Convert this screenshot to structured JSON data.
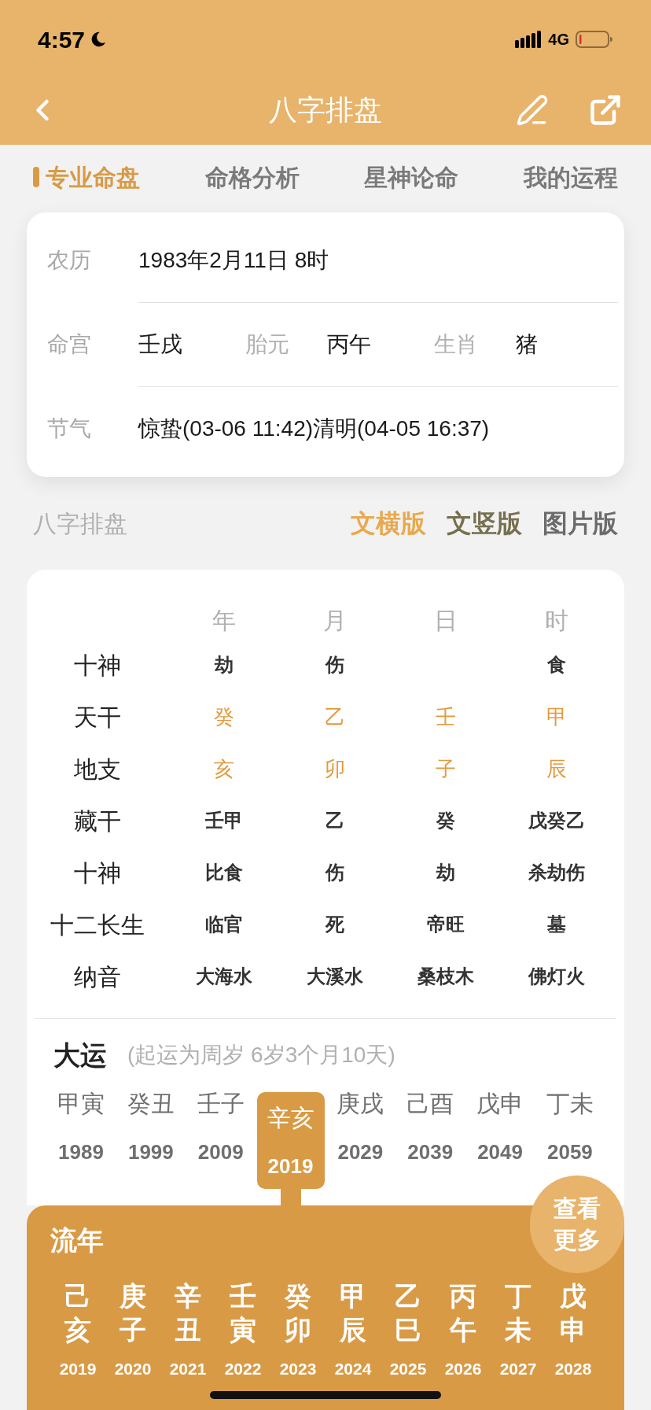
{
  "status_bar": {
    "time": "4:57",
    "network": "4G"
  },
  "nav": {
    "title": "八字排盘"
  },
  "tabs": [
    {
      "label": "专业命盘",
      "selected": true
    },
    {
      "label": "命格分析",
      "selected": false
    },
    {
      "label": "星神论命",
      "selected": false
    },
    {
      "label": "我的运程",
      "selected": false
    }
  ],
  "info": [
    {
      "items": [
        {
          "label": "农历",
          "value": "1983年2月11日 8时"
        }
      ]
    },
    {
      "items": [
        {
          "label": "命宫",
          "value": "壬戌"
        },
        {
          "label": "胎元",
          "value": "丙午"
        },
        {
          "label": "生肖",
          "value": "猪"
        }
      ]
    },
    {
      "items": [
        {
          "label": "节气",
          "value": "惊蛰(03-06 11:42)清明(04-05 16:37)"
        }
      ]
    }
  ],
  "section": {
    "title": "八字排盘",
    "versions": [
      {
        "label": "文横版",
        "color": "#e8a94e"
      },
      {
        "label": "文竖版",
        "color": "#76704f"
      },
      {
        "label": "图片版",
        "color": "#6b6b6b"
      }
    ]
  },
  "chart": {
    "columns": [
      "年",
      "月",
      "日",
      "时"
    ],
    "rows": [
      {
        "label": "十神",
        "highlight": false,
        "cells": [
          "劫",
          "伤",
          null,
          "食"
        ]
      },
      {
        "label": "天干",
        "highlight": true,
        "cells": [
          "癸",
          "乙",
          "壬",
          "甲"
        ]
      },
      {
        "label": "地支",
        "highlight": true,
        "cells": [
          "亥",
          "卯",
          "子",
          "辰"
        ]
      },
      {
        "label": "藏干",
        "highlight": false,
        "cells": [
          "壬甲",
          "乙",
          "癸",
          "戊癸乙"
        ]
      },
      {
        "label": "十神",
        "highlight": false,
        "cells": [
          "比食",
          "伤",
          "劫",
          "杀劫伤"
        ]
      },
      {
        "label": "十二长生",
        "highlight": false,
        "cells": [
          "临官",
          "死",
          "帝旺",
          "墓"
        ]
      },
      {
        "label": "纳音",
        "highlight": false,
        "cells": [
          "大海水",
          "大溪水",
          "桑枝木",
          "佛灯火"
        ]
      }
    ]
  },
  "dayun": {
    "title": "大运",
    "note": "(起运为周岁 6岁3个月10天)",
    "items": [
      {
        "pillar": "甲寅",
        "year": "1989",
        "selected": false
      },
      {
        "pillar": "癸丑",
        "year": "1999",
        "selected": false
      },
      {
        "pillar": "壬子",
        "year": "2009",
        "selected": false
      },
      {
        "pillar": "辛亥",
        "year": "2019",
        "selected": true
      },
      {
        "pillar": "庚戌",
        "year": "2029",
        "selected": false
      },
      {
        "pillar": "己酉",
        "year": "2039",
        "selected": false
      },
      {
        "pillar": "戊申",
        "year": "2049",
        "selected": false
      },
      {
        "pillar": "丁未",
        "year": "2059",
        "selected": false
      }
    ]
  },
  "liunian": {
    "title": "流年",
    "more": "查看更多",
    "items": [
      {
        "stem": "己",
        "branch": "亥",
        "year": "2019"
      },
      {
        "stem": "庚",
        "branch": "子",
        "year": "2020"
      },
      {
        "stem": "辛",
        "branch": "丑",
        "year": "2021"
      },
      {
        "stem": "壬",
        "branch": "寅",
        "year": "2022"
      },
      {
        "stem": "癸",
        "branch": "卯",
        "year": "2023"
      },
      {
        "stem": "甲",
        "branch": "辰",
        "year": "2024"
      },
      {
        "stem": "乙",
        "branch": "巳",
        "year": "2025"
      },
      {
        "stem": "丙",
        "branch": "午",
        "year": "2026"
      },
      {
        "stem": "丁",
        "branch": "未",
        "year": "2027"
      },
      {
        "stem": "戊",
        "branch": "申",
        "year": "2028"
      }
    ]
  }
}
